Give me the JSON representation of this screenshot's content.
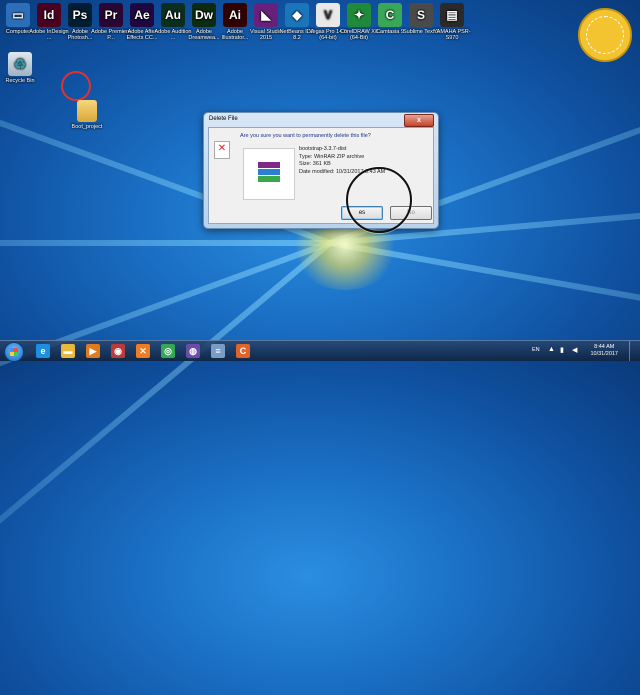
{
  "desktop": {
    "top_icons": [
      {
        "label": "Computer",
        "icon": "computer-icon",
        "glyph": "▭",
        "color": "#2c6fb8"
      },
      {
        "label": "Adobe InDesign ...",
        "icon": "indesign-icon",
        "glyph": "Id",
        "color": "#49021f"
      },
      {
        "label": "Adobe Photosh...",
        "icon": "photoshop-icon",
        "glyph": "Ps",
        "color": "#001d34"
      },
      {
        "label": "Adobe Premiere P...",
        "icon": "premiere-icon",
        "glyph": "Pr",
        "color": "#2a0634"
      },
      {
        "label": "Adobe After Effects CC...",
        "icon": "after-effects-icon",
        "glyph": "Ae",
        "color": "#1f0740"
      },
      {
        "label": "Adobe Audition ...",
        "icon": "audition-icon",
        "glyph": "Au",
        "color": "#0b2e1f"
      },
      {
        "label": "Adobe Dreamwea...",
        "icon": "dreamweaver-icon",
        "glyph": "Dw",
        "color": "#0d2a12"
      },
      {
        "label": "Adobe Illustrator...",
        "icon": "illustrator-icon",
        "glyph": "Ai",
        "color": "#330000"
      },
      {
        "label": "Visual Studio 2015",
        "icon": "visual-studio-icon",
        "glyph": "◣",
        "color": "#68217a"
      },
      {
        "label": "NetBeans IDE 8.2",
        "icon": "netbeans-icon",
        "glyph": "◆",
        "color": "#1b75bb"
      },
      {
        "label": "Vegas Pro 14.0 (64-bit)",
        "icon": "vegas-icon",
        "glyph": "V",
        "color": "#e8e8e8"
      },
      {
        "label": "CorelDRAW X8 (64-Bit)",
        "icon": "coreldraw-icon",
        "glyph": "✦",
        "color": "#1f8a3a"
      },
      {
        "label": "Camtasia 9",
        "icon": "camtasia-icon",
        "glyph": "C",
        "color": "#3aa657"
      },
      {
        "label": "Sublime Text 3",
        "icon": "sublime-icon",
        "glyph": "S",
        "color": "#4a4a4a"
      },
      {
        "label": "YAMAHA PSR-S970",
        "icon": "yamaha-icon",
        "glyph": "▤",
        "color": "#2a2a2a"
      }
    ],
    "recycle_bin": "Recycle Bin",
    "folder_label": "Boot_project"
  },
  "dialog": {
    "title": "Delete File",
    "close": "x",
    "message": "Are you sure you want to permanently delete this file?",
    "file_name": "bootstrap-3.3.7-dist",
    "file_type": "Type: WinRAR ZIP archive",
    "file_size": "Size: 361 KB",
    "file_modified": "Date modified: 10/31/2017 8:43 AM",
    "yes_label": "es",
    "no_label": "No"
  },
  "taskbar": {
    "apps": [
      {
        "icon": "ie-icon",
        "glyph": "e",
        "color": "#1d8fe0"
      },
      {
        "icon": "explorer-icon",
        "glyph": "▬",
        "color": "#e8b93c"
      },
      {
        "icon": "media-player-icon",
        "glyph": "▶",
        "color": "#e07b1d"
      },
      {
        "icon": "avatar-app-icon",
        "glyph": "◉",
        "color": "#bb3b3b"
      },
      {
        "icon": "xampp-icon",
        "glyph": "✕",
        "color": "#f07b21"
      },
      {
        "icon": "chrome-icon",
        "glyph": "◎",
        "color": "#34a853"
      },
      {
        "icon": "app-icon",
        "glyph": "◍",
        "color": "#6b4ca8"
      },
      {
        "icon": "notepad-icon",
        "glyph": "≡",
        "color": "#7a9cc6"
      },
      {
        "icon": "camtasia-taskbar-icon",
        "glyph": "C",
        "color": "#e0642a"
      }
    ],
    "language": "EN",
    "time": "8:44 AM",
    "date": "10/31/2017"
  }
}
